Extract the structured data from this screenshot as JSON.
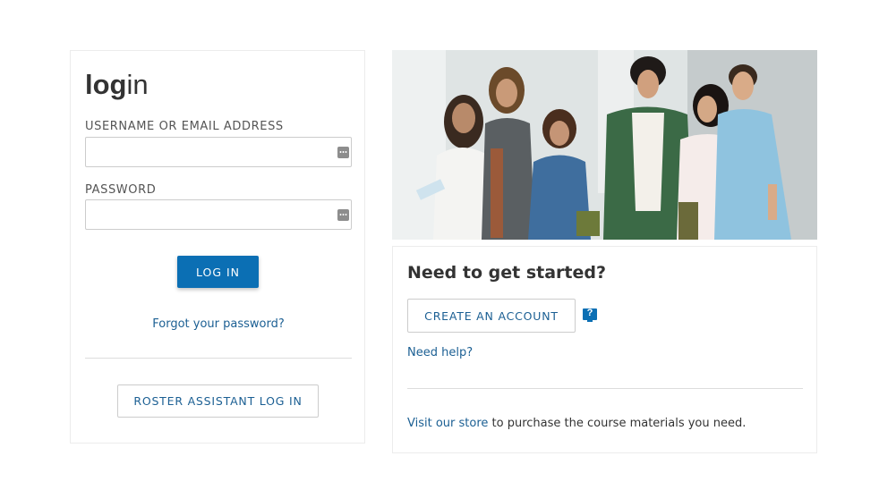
{
  "login": {
    "title_bold": "log",
    "title_light": "in",
    "username_label": "USERNAME OR EMAIL ADDRESS",
    "username_value": "",
    "password_label": "PASSWORD",
    "password_value": "",
    "login_button": "LOG IN",
    "forgot_link": "Forgot your password?",
    "roster_button": "ROSTER ASSISTANT LOG IN",
    "field_icon": "password-manager-icon"
  },
  "signup": {
    "title": "Need to get started?",
    "create_button": "CREATE AN ACCOUNT",
    "help_icon_glyph": "?",
    "help_icon": "help-monitor-icon",
    "need_help_link": "Need help?",
    "store_link": "Visit our store",
    "store_text": " to purchase the course materials you need."
  },
  "hero": {
    "image": "students-walking-photo"
  },
  "colors": {
    "primary": "#0b6fb4",
    "link": "#1b5f93",
    "border": "#cccccc"
  }
}
